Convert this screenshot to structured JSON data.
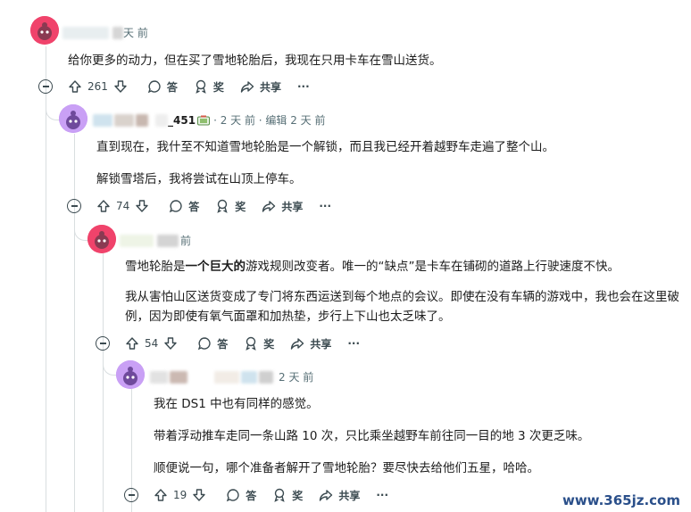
{
  "icons": {
    "upvote": "arrow-up-icon",
    "downvote": "arrow-down-icon",
    "reply": "speech-bubble-icon",
    "award": "award-ribbon-icon",
    "share": "share-arrow-icon",
    "more": "more-dots-icon",
    "collapse": "minus-circle-icon"
  },
  "colors": {
    "avatar_red": "#f0436b",
    "avatar_purple": "#b983f0",
    "thread_line": "#d9dee0",
    "meta_gray": "#576f76"
  },
  "comments": [
    {
      "time": "天 前",
      "paragraphs": [
        "给你更多的动力，但在买了雪地轮胎后，我现在只用卡车在雪山送货。"
      ],
      "votes": "261",
      "reply_label": "答",
      "award_label": "奖",
      "share_label": "共享",
      "more_label": "···"
    },
    {
      "username_suffix": "_451",
      "time": "· 2 天 前 · 编辑 2 天 前",
      "paragraphs": [
        "直到现在，我什至不知道雪地轮胎是一个解锁，而且我已经开着越野车走遍了整个山。",
        "解锁雪塔后，我将尝试在山顶上停车。"
      ],
      "votes": "74",
      "reply_label": "答",
      "award_label": "奖",
      "share_label": "共享",
      "more_label": "···"
    },
    {
      "time": "前",
      "p1_a": "雪地轮胎是",
      "p1_b": "一个巨大的",
      "p1_c": "游戏规则改变者。唯一的“缺点”是卡车在铺砌的道路上行驶速度不快。",
      "paragraphs": [
        "我从害怕山区送货变成了专门将东西运送到每个地点的会议。即使在没有车辆的游戏中，我也会在这里破例，因为即使有氧气面罩和加热垫，步行上下山也太乏味了。"
      ],
      "votes": "54",
      "reply_label": "答",
      "award_label": "奖",
      "share_label": "共享",
      "more_label": "···"
    },
    {
      "time": "2 天 前",
      "paragraphs": [
        "我在 DS1 中也有同样的感觉。",
        "带着浮动推车走同一条山路 10 次，只比乘坐越野车前往同一目的地 3 次更乏味。",
        "顺便说一句，哪个准备者解开了雪地轮胎？要尽快去给他们五星，哈哈。"
      ],
      "votes": "19",
      "reply_label": "答",
      "award_label": "奖",
      "share_label": "共享",
      "more_label": "···"
    }
  ],
  "watermark": "www.365jz.com"
}
